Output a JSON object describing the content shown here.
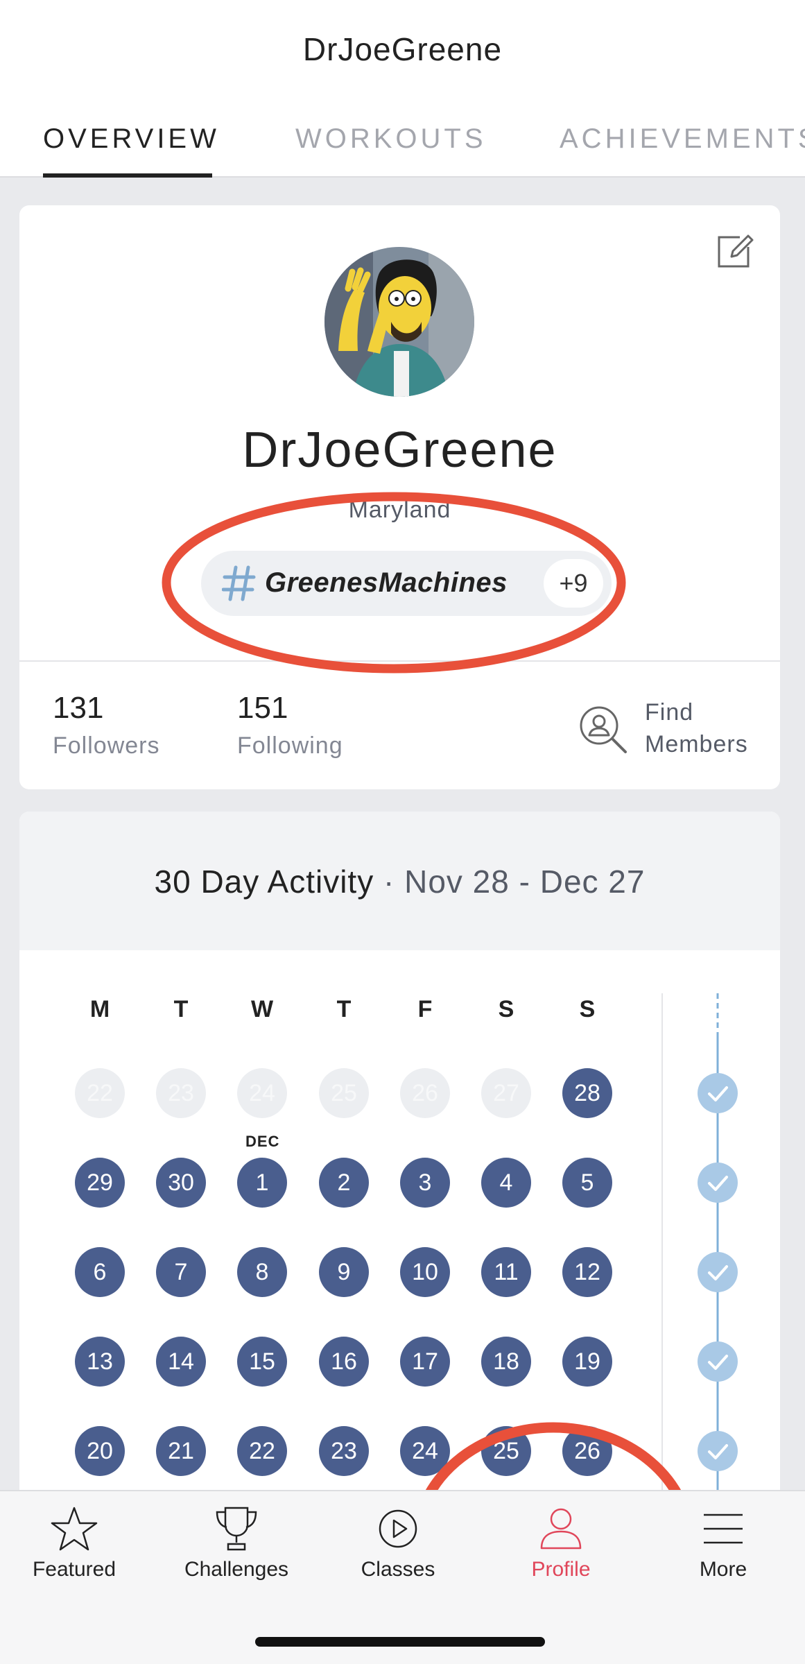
{
  "header": {
    "title": "DrJoeGreene",
    "tabs": [
      {
        "label": "OVERVIEW",
        "active": true
      },
      {
        "label": "WORKOUTS",
        "active": false
      },
      {
        "label": "ACHIEVEMENTS",
        "active": false
      }
    ]
  },
  "profile": {
    "username": "DrJoeGreene",
    "location": "Maryland",
    "tag": {
      "name": "GreenesMachines",
      "extra_count": "+9"
    },
    "followers": {
      "count": "131",
      "label": "Followers"
    },
    "following": {
      "count": "151",
      "label": "Following"
    },
    "find_members_label": "Find Members",
    "icons": {
      "edit": "edit-icon",
      "hashtag": "hashtag-icon",
      "find": "search-user-icon"
    }
  },
  "activity": {
    "title": "30 Day Activity",
    "separator": " · ",
    "range": "Nov 28 - Dec 27",
    "weekdays": [
      "M",
      "T",
      "W",
      "T",
      "F",
      "S",
      "S"
    ],
    "month_marker": "DEC",
    "weeks": [
      [
        {
          "d": "22",
          "in": false
        },
        {
          "d": "23",
          "in": false
        },
        {
          "d": "24",
          "in": false
        },
        {
          "d": "25",
          "in": false
        },
        {
          "d": "26",
          "in": false
        },
        {
          "d": "27",
          "in": false
        },
        {
          "d": "28",
          "in": true
        }
      ],
      [
        {
          "d": "29",
          "in": true
        },
        {
          "d": "30",
          "in": true
        },
        {
          "d": "1",
          "in": true
        },
        {
          "d": "2",
          "in": true
        },
        {
          "d": "3",
          "in": true
        },
        {
          "d": "4",
          "in": true
        },
        {
          "d": "5",
          "in": true
        }
      ],
      [
        {
          "d": "6",
          "in": true
        },
        {
          "d": "7",
          "in": true
        },
        {
          "d": "8",
          "in": true
        },
        {
          "d": "9",
          "in": true
        },
        {
          "d": "10",
          "in": true
        },
        {
          "d": "11",
          "in": true
        },
        {
          "d": "12",
          "in": true
        }
      ],
      [
        {
          "d": "13",
          "in": true
        },
        {
          "d": "14",
          "in": true
        },
        {
          "d": "15",
          "in": true
        },
        {
          "d": "16",
          "in": true
        },
        {
          "d": "17",
          "in": true
        },
        {
          "d": "18",
          "in": true
        },
        {
          "d": "19",
          "in": true
        }
      ],
      [
        {
          "d": "20",
          "in": true
        },
        {
          "d": "21",
          "in": true
        },
        {
          "d": "22",
          "in": true
        },
        {
          "d": "23",
          "in": true
        },
        {
          "d": "24",
          "in": true
        },
        {
          "d": "25",
          "in": true
        },
        {
          "d": "26",
          "in": true
        }
      ]
    ],
    "week_goals_met": [
      true,
      true,
      true,
      true,
      true
    ],
    "colors": {
      "active_day": "#4a5e8e",
      "inactive_day": "#eceef1",
      "goal_check": "#a9c9e6"
    }
  },
  "bottom_nav": {
    "items": [
      {
        "label": "Featured",
        "icon": "star-icon",
        "active": false
      },
      {
        "label": "Challenges",
        "icon": "trophy-icon",
        "active": false
      },
      {
        "label": "Classes",
        "icon": "play-circle-icon",
        "active": false
      },
      {
        "label": "Profile",
        "icon": "person-icon",
        "active": true
      },
      {
        "label": "More",
        "icon": "menu-icon",
        "active": false
      }
    ]
  },
  "annotation_color": "#e8503a",
  "accent_color": "#e0465a"
}
